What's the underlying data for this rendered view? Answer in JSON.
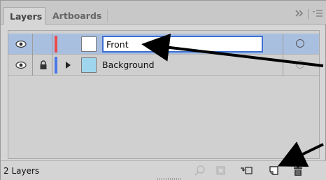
{
  "tabs": {
    "layers_label": "Layers",
    "artboards_label": "Artboards",
    "collapse_icon": "double-chevron-right-icon",
    "menu_icon": "panel-menu-icon"
  },
  "layers": [
    {
      "name": "Front",
      "editing": true,
      "visible": true,
      "locked": false,
      "color": "#e94b4b",
      "thumb_color": "#ffffff",
      "has_children": false
    },
    {
      "name": "Background",
      "editing": false,
      "visible": true,
      "locked": true,
      "color": "#4b78e9",
      "thumb_color": "#9fd6ee",
      "has_children": true
    }
  ],
  "footer": {
    "count_label": "2 Layers",
    "buttons": [
      "locate-object-icon",
      "make-clipping-mask-icon",
      "create-sublayer-icon",
      "create-new-layer-icon",
      "delete-icon"
    ]
  },
  "colors": {
    "selection_row": "#a9bfe0",
    "edit_border": "#3d6fd1",
    "arrow": "#000000"
  }
}
